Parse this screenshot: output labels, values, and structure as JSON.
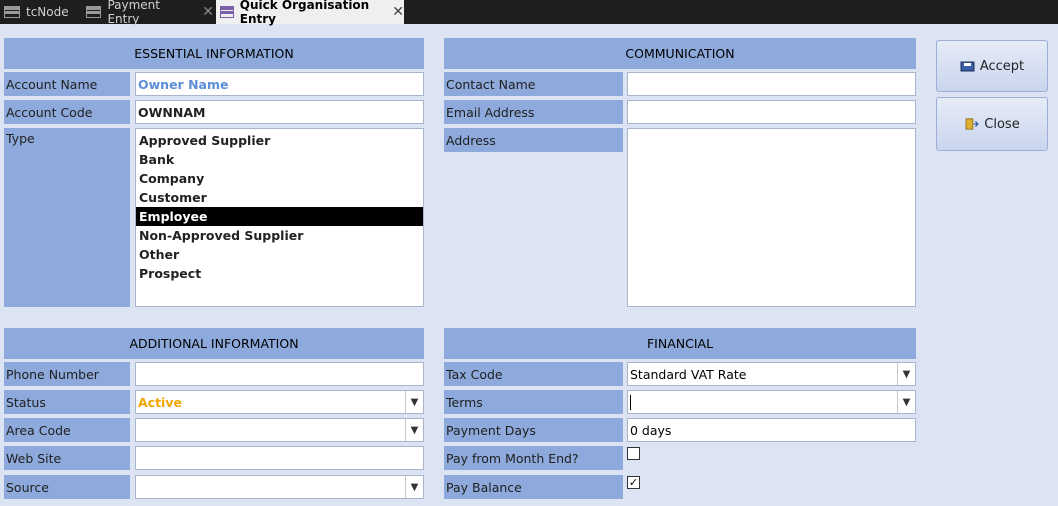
{
  "tabs": [
    {
      "label": "tcNode"
    },
    {
      "label": "Payment Entry"
    },
    {
      "label": "Quick Organisation Entry"
    }
  ],
  "sections": {
    "essential": "ESSENTIAL INFORMATION",
    "communication": "COMMUNICATION",
    "additional": "ADDITIONAL INFORMATION",
    "financial": "FINANCIAL"
  },
  "essential": {
    "account_name_label": "Account Name",
    "account_name_value": "Owner Name",
    "account_code_label": "Account Code",
    "account_code_value": "OWNNAM",
    "type_label": "Type",
    "type_options": [
      "Approved Supplier",
      "Bank",
      "Company",
      "Customer",
      "Employee",
      "Non-Approved Supplier",
      "Other",
      "Prospect"
    ],
    "type_selected": "Employee"
  },
  "communication": {
    "contact_name_label": "Contact Name",
    "contact_name_value": "",
    "email_label": "Email Address",
    "email_value": "",
    "address_label": "Address",
    "address_value": ""
  },
  "additional": {
    "phone_label": "Phone Number",
    "phone_value": "",
    "status_label": "Status",
    "status_value": "Active",
    "area_code_label": "Area Code",
    "area_code_value": "",
    "web_site_label": "Web Site",
    "web_site_value": "",
    "source_label": "Source",
    "source_value": ""
  },
  "financial": {
    "tax_code_label": "Tax Code",
    "tax_code_value": "Standard VAT Rate",
    "terms_label": "Terms",
    "terms_value": "",
    "payment_days_label": "Payment Days",
    "payment_days_value": "0 days",
    "pay_month_end_label": "Pay from Month End?",
    "pay_month_end_checked": false,
    "pay_balance_label": "Pay Balance",
    "pay_balance_checked": true
  },
  "buttons": {
    "accept": "Accept",
    "close": "Close"
  },
  "colors": {
    "panel_blue": "#8ea9db",
    "background": "#dce3f2",
    "selection": "#000000",
    "name_text": "#5b8ed6",
    "status_text": "#f0a500"
  }
}
